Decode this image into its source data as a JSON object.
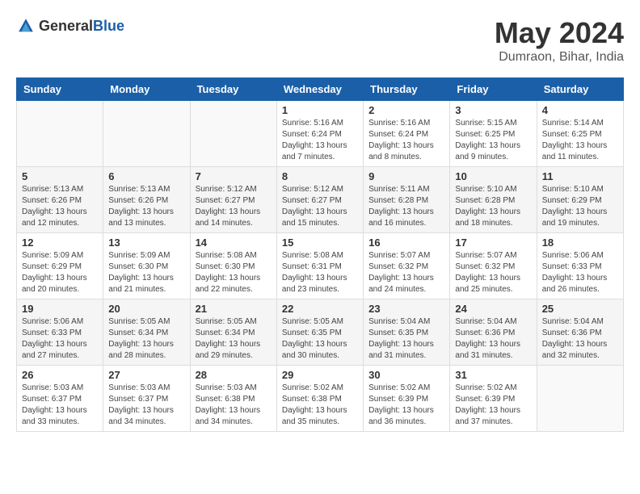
{
  "header": {
    "logo_general": "General",
    "logo_blue": "Blue",
    "month_year": "May 2024",
    "location": "Dumraon, Bihar, India"
  },
  "weekdays": [
    "Sunday",
    "Monday",
    "Tuesday",
    "Wednesday",
    "Thursday",
    "Friday",
    "Saturday"
  ],
  "weeks": [
    [
      {
        "day": "",
        "sunrise": "",
        "sunset": "",
        "daylight": ""
      },
      {
        "day": "",
        "sunrise": "",
        "sunset": "",
        "daylight": ""
      },
      {
        "day": "",
        "sunrise": "",
        "sunset": "",
        "daylight": ""
      },
      {
        "day": "1",
        "sunrise": "Sunrise: 5:16 AM",
        "sunset": "Sunset: 6:24 PM",
        "daylight": "Daylight: 13 hours and 7 minutes."
      },
      {
        "day": "2",
        "sunrise": "Sunrise: 5:16 AM",
        "sunset": "Sunset: 6:24 PM",
        "daylight": "Daylight: 13 hours and 8 minutes."
      },
      {
        "day": "3",
        "sunrise": "Sunrise: 5:15 AM",
        "sunset": "Sunset: 6:25 PM",
        "daylight": "Daylight: 13 hours and 9 minutes."
      },
      {
        "day": "4",
        "sunrise": "Sunrise: 5:14 AM",
        "sunset": "Sunset: 6:25 PM",
        "daylight": "Daylight: 13 hours and 11 minutes."
      }
    ],
    [
      {
        "day": "5",
        "sunrise": "Sunrise: 5:13 AM",
        "sunset": "Sunset: 6:26 PM",
        "daylight": "Daylight: 13 hours and 12 minutes."
      },
      {
        "day": "6",
        "sunrise": "Sunrise: 5:13 AM",
        "sunset": "Sunset: 6:26 PM",
        "daylight": "Daylight: 13 hours and 13 minutes."
      },
      {
        "day": "7",
        "sunrise": "Sunrise: 5:12 AM",
        "sunset": "Sunset: 6:27 PM",
        "daylight": "Daylight: 13 hours and 14 minutes."
      },
      {
        "day": "8",
        "sunrise": "Sunrise: 5:12 AM",
        "sunset": "Sunset: 6:27 PM",
        "daylight": "Daylight: 13 hours and 15 minutes."
      },
      {
        "day": "9",
        "sunrise": "Sunrise: 5:11 AM",
        "sunset": "Sunset: 6:28 PM",
        "daylight": "Daylight: 13 hours and 16 minutes."
      },
      {
        "day": "10",
        "sunrise": "Sunrise: 5:10 AM",
        "sunset": "Sunset: 6:28 PM",
        "daylight": "Daylight: 13 hours and 18 minutes."
      },
      {
        "day": "11",
        "sunrise": "Sunrise: 5:10 AM",
        "sunset": "Sunset: 6:29 PM",
        "daylight": "Daylight: 13 hours and 19 minutes."
      }
    ],
    [
      {
        "day": "12",
        "sunrise": "Sunrise: 5:09 AM",
        "sunset": "Sunset: 6:29 PM",
        "daylight": "Daylight: 13 hours and 20 minutes."
      },
      {
        "day": "13",
        "sunrise": "Sunrise: 5:09 AM",
        "sunset": "Sunset: 6:30 PM",
        "daylight": "Daylight: 13 hours and 21 minutes."
      },
      {
        "day": "14",
        "sunrise": "Sunrise: 5:08 AM",
        "sunset": "Sunset: 6:30 PM",
        "daylight": "Daylight: 13 hours and 22 minutes."
      },
      {
        "day": "15",
        "sunrise": "Sunrise: 5:08 AM",
        "sunset": "Sunset: 6:31 PM",
        "daylight": "Daylight: 13 hours and 23 minutes."
      },
      {
        "day": "16",
        "sunrise": "Sunrise: 5:07 AM",
        "sunset": "Sunset: 6:32 PM",
        "daylight": "Daylight: 13 hours and 24 minutes."
      },
      {
        "day": "17",
        "sunrise": "Sunrise: 5:07 AM",
        "sunset": "Sunset: 6:32 PM",
        "daylight": "Daylight: 13 hours and 25 minutes."
      },
      {
        "day": "18",
        "sunrise": "Sunrise: 5:06 AM",
        "sunset": "Sunset: 6:33 PM",
        "daylight": "Daylight: 13 hours and 26 minutes."
      }
    ],
    [
      {
        "day": "19",
        "sunrise": "Sunrise: 5:06 AM",
        "sunset": "Sunset: 6:33 PM",
        "daylight": "Daylight: 13 hours and 27 minutes."
      },
      {
        "day": "20",
        "sunrise": "Sunrise: 5:05 AM",
        "sunset": "Sunset: 6:34 PM",
        "daylight": "Daylight: 13 hours and 28 minutes."
      },
      {
        "day": "21",
        "sunrise": "Sunrise: 5:05 AM",
        "sunset": "Sunset: 6:34 PM",
        "daylight": "Daylight: 13 hours and 29 minutes."
      },
      {
        "day": "22",
        "sunrise": "Sunrise: 5:05 AM",
        "sunset": "Sunset: 6:35 PM",
        "daylight": "Daylight: 13 hours and 30 minutes."
      },
      {
        "day": "23",
        "sunrise": "Sunrise: 5:04 AM",
        "sunset": "Sunset: 6:35 PM",
        "daylight": "Daylight: 13 hours and 31 minutes."
      },
      {
        "day": "24",
        "sunrise": "Sunrise: 5:04 AM",
        "sunset": "Sunset: 6:36 PM",
        "daylight": "Daylight: 13 hours and 31 minutes."
      },
      {
        "day": "25",
        "sunrise": "Sunrise: 5:04 AM",
        "sunset": "Sunset: 6:36 PM",
        "daylight": "Daylight: 13 hours and 32 minutes."
      }
    ],
    [
      {
        "day": "26",
        "sunrise": "Sunrise: 5:03 AM",
        "sunset": "Sunset: 6:37 PM",
        "daylight": "Daylight: 13 hours and 33 minutes."
      },
      {
        "day": "27",
        "sunrise": "Sunrise: 5:03 AM",
        "sunset": "Sunset: 6:37 PM",
        "daylight": "Daylight: 13 hours and 34 minutes."
      },
      {
        "day": "28",
        "sunrise": "Sunrise: 5:03 AM",
        "sunset": "Sunset: 6:38 PM",
        "daylight": "Daylight: 13 hours and 34 minutes."
      },
      {
        "day": "29",
        "sunrise": "Sunrise: 5:02 AM",
        "sunset": "Sunset: 6:38 PM",
        "daylight": "Daylight: 13 hours and 35 minutes."
      },
      {
        "day": "30",
        "sunrise": "Sunrise: 5:02 AM",
        "sunset": "Sunset: 6:39 PM",
        "daylight": "Daylight: 13 hours and 36 minutes."
      },
      {
        "day": "31",
        "sunrise": "Sunrise: 5:02 AM",
        "sunset": "Sunset: 6:39 PM",
        "daylight": "Daylight: 13 hours and 37 minutes."
      },
      {
        "day": "",
        "sunrise": "",
        "sunset": "",
        "daylight": ""
      }
    ]
  ]
}
